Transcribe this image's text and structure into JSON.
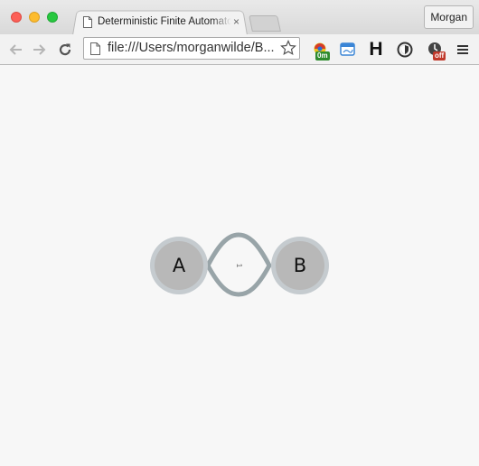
{
  "window": {
    "tab_title": "Deterministic Finite Automaton",
    "tab_close": "×",
    "profile_name": "Morgan"
  },
  "toolbar": {
    "url": "file:///Users/morganwilde/B...",
    "extensions": [
      {
        "name": "timer-extension-icon",
        "badge": "0m",
        "badge_color": "#2e8b2e"
      },
      {
        "name": "browser-window-icon"
      },
      {
        "name": "headings-icon",
        "glyph": "H"
      },
      {
        "name": "shield-icon"
      },
      {
        "name": "clock-extension-icon",
        "badge": "off",
        "badge_color": "#c0392b"
      }
    ]
  },
  "diagram": {
    "states": [
      {
        "label": "A"
      },
      {
        "label": "B"
      }
    ],
    "transition_label": "1",
    "colors": {
      "node_fill": "#b8b8b8",
      "node_ring": "#c5cbcf",
      "edge": "#98a4a8"
    }
  }
}
